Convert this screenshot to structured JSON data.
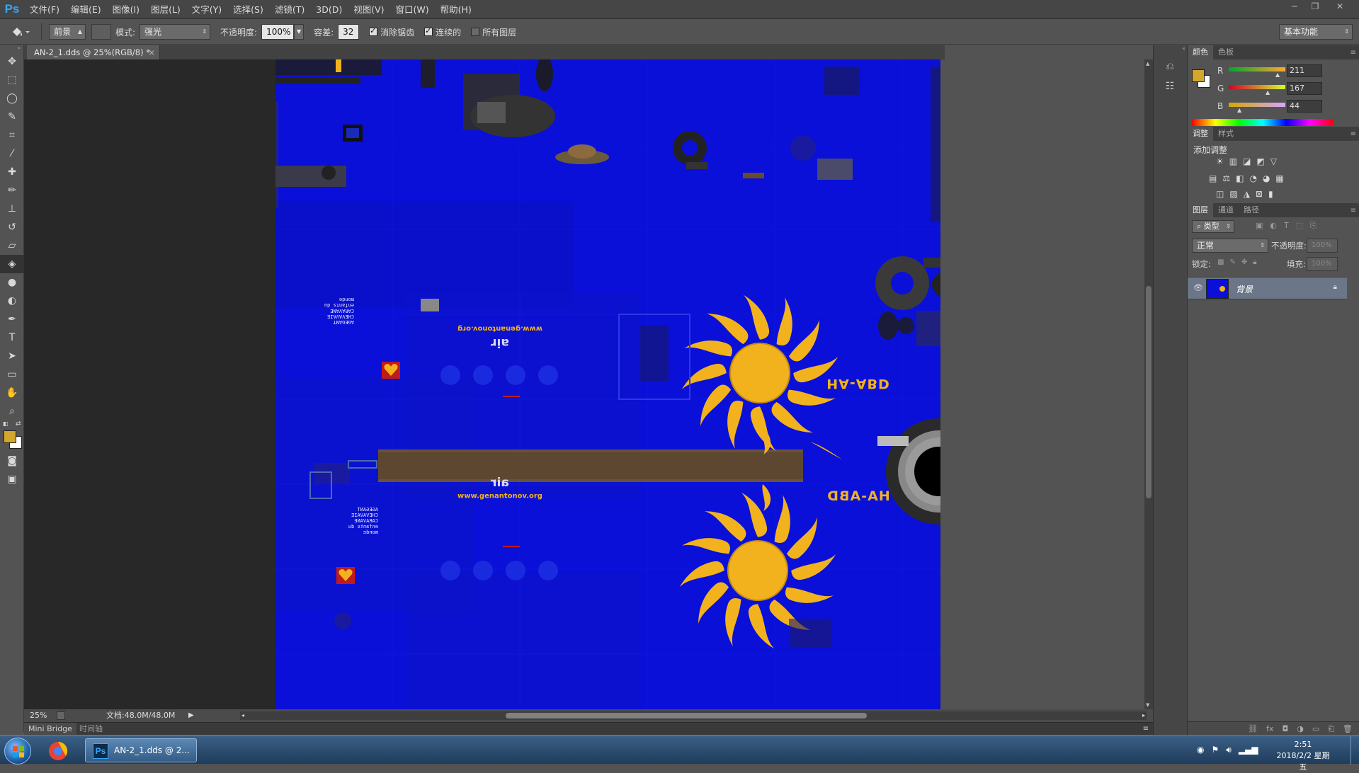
{
  "app": {
    "logo": "Ps",
    "menus": [
      "文件(F)",
      "编辑(E)",
      "图像(I)",
      "图层(L)",
      "文字(Y)",
      "选择(S)",
      "滤镜(T)",
      "3D(D)",
      "视图(V)",
      "窗口(W)",
      "帮助(H)"
    ],
    "window_controls": [
      "─",
      "❐",
      "✕"
    ]
  },
  "options": {
    "source_value": "前景",
    "mode_label": "模式:",
    "mode_value": "强光",
    "opacity_label": "不透明度:",
    "opacity_value": "100%",
    "tolerance_label": "容差:",
    "tolerance_value": "32",
    "antialias_label": "消除锯齿",
    "antialias_checked": true,
    "contiguous_label": "连续的",
    "contiguous_checked": true,
    "all_layers_label": "所有图层",
    "all_layers_checked": false,
    "workspace_value": "基本功能"
  },
  "document": {
    "tab_title": "AN-2_1.dds @ 25%(RGB/8) *",
    "zoom": "25%",
    "doc_size": "文档:48.0M/48.0M"
  },
  "canvas": {
    "registration_top": "HA-ABD",
    "registration_bottom": "HA-ABD",
    "air_top": "air",
    "air_bottom": "air",
    "url_top": "www.genantonov.org",
    "url_bottom": "www.genantonov.org",
    "charity_lines": [
      "AGEGANT",
      "CHEVAVAIE",
      "CARAVANE"
    ],
    "charity_footer": "enfants du monde"
  },
  "bottom_panel": {
    "tabs": [
      "Mini Bridge",
      "时间轴"
    ]
  },
  "color_panel": {
    "tabs": [
      "颜色",
      "色板"
    ],
    "swatch": "#d3a72c",
    "channels": [
      {
        "label": "R",
        "value": "211"
      },
      {
        "label": "G",
        "value": "167"
      },
      {
        "label": "B",
        "value": "44"
      }
    ]
  },
  "adjustments_panel": {
    "tabs": [
      "调整",
      "样式"
    ],
    "title": "添加调整"
  },
  "layers_panel": {
    "tabs": [
      "图层",
      "通道",
      "路径"
    ],
    "filter_value": "类型",
    "blend_value": "正常",
    "opacity_label": "不透明度:",
    "opacity_value": "100%",
    "lock_label": "锁定:",
    "fill_label": "填充:",
    "fill_value": "100%",
    "layers": [
      {
        "name": "背景"
      }
    ]
  },
  "taskbar": {
    "app_label": "AN-2_1.dds @ 2...",
    "time": "2:51",
    "date": "2018/2/2 星期五"
  },
  "colors": {
    "canvas_blue": "#0a10d8",
    "sun_yellow": "#f2b21e",
    "foreground": "#d3a72c",
    "background": "#ffffff"
  }
}
